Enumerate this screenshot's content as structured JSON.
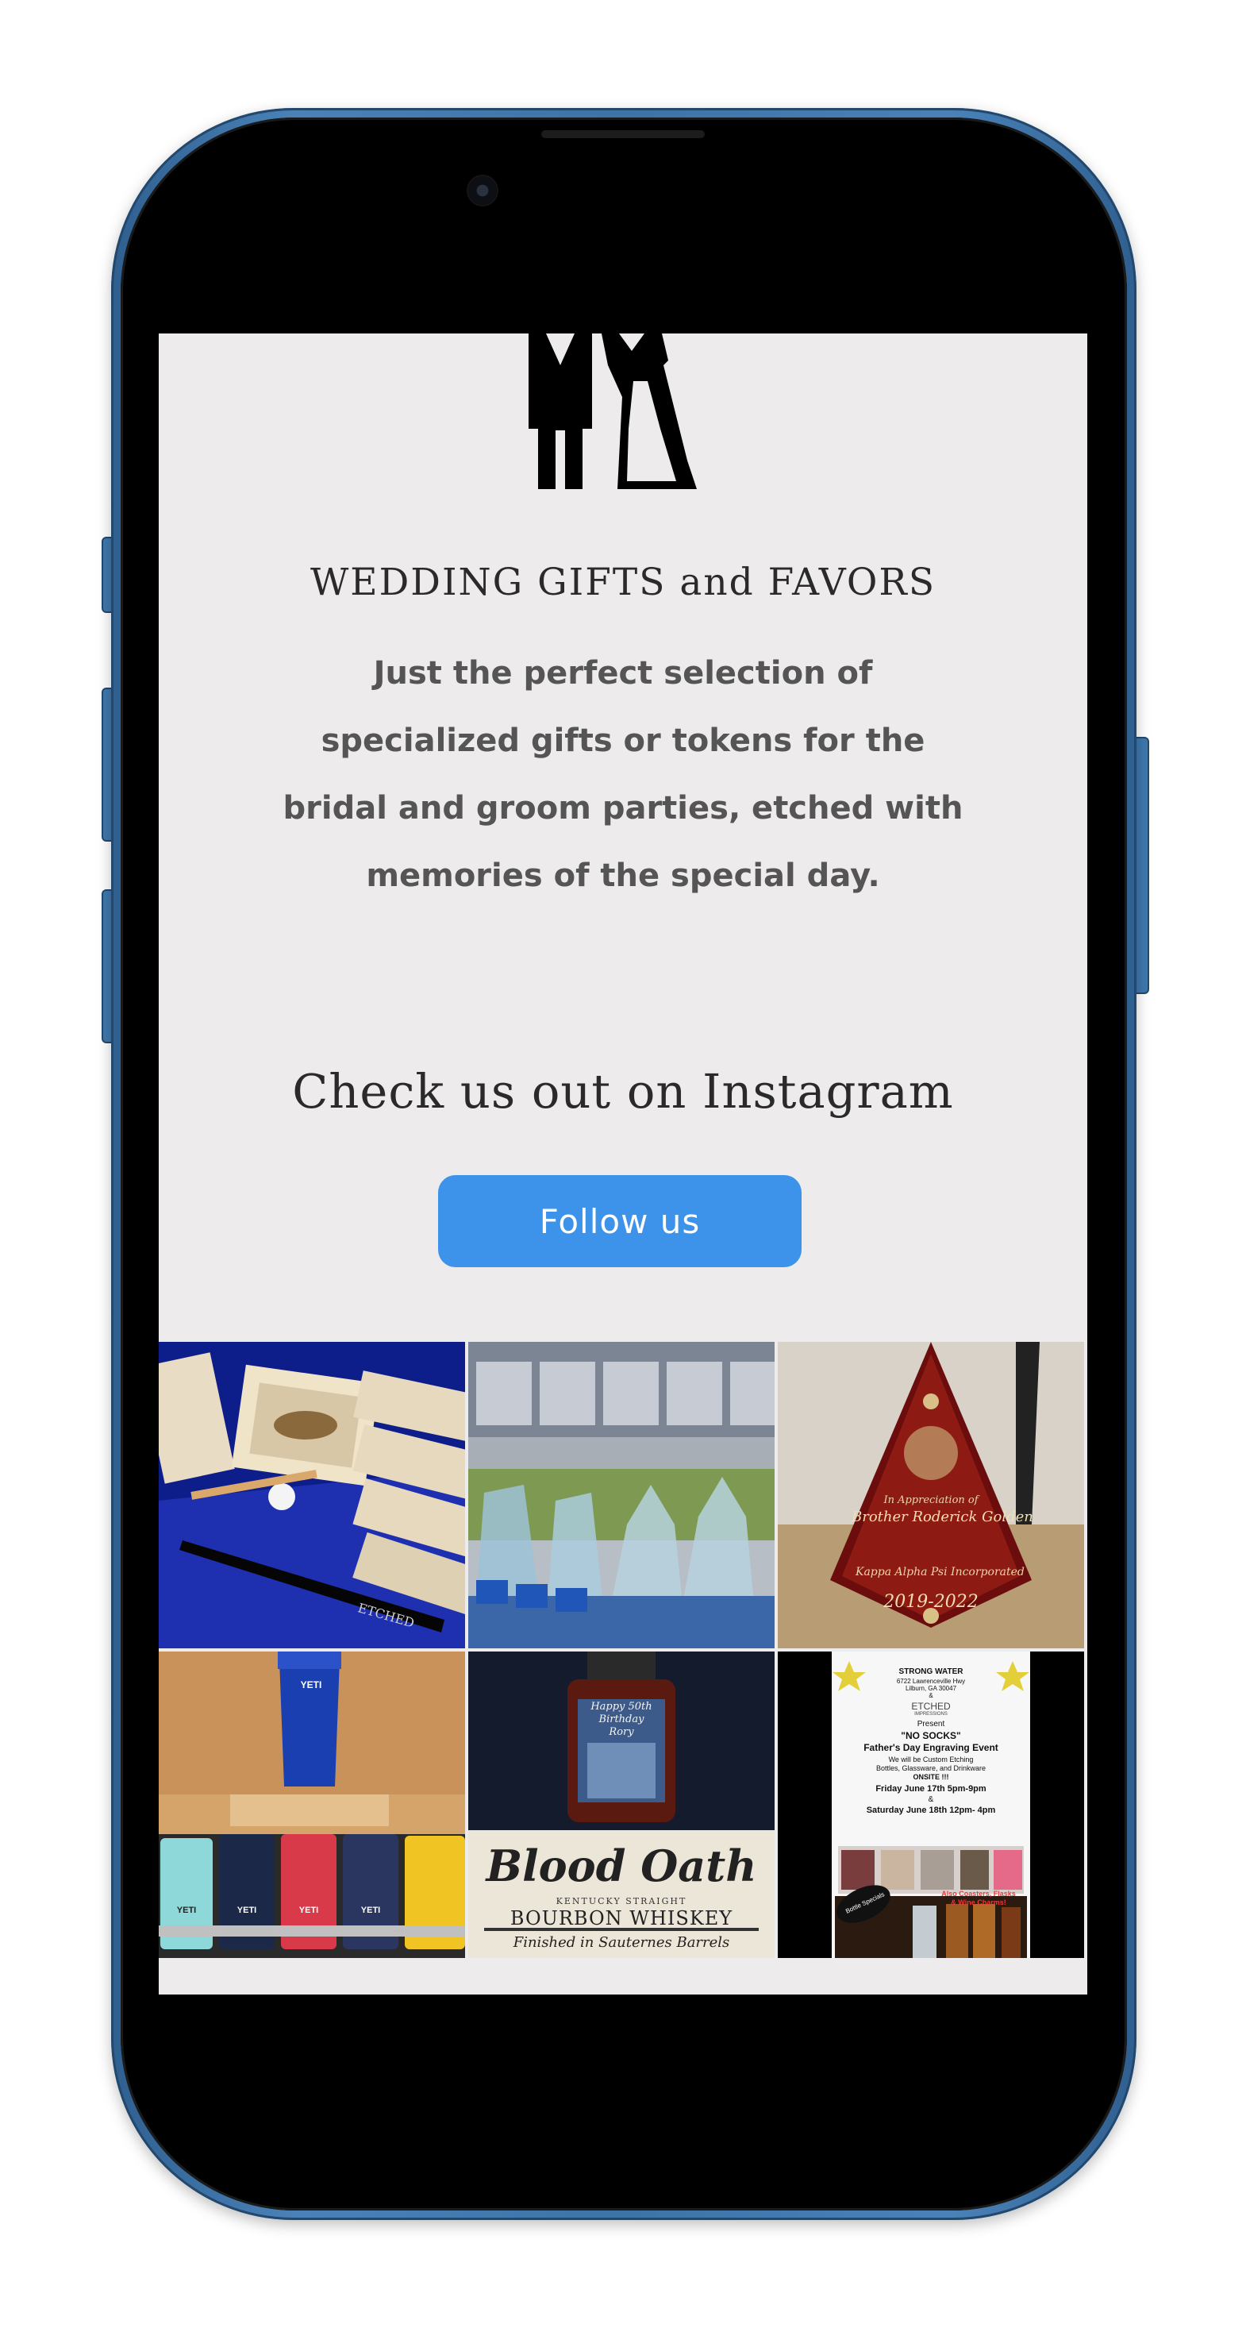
{
  "section": {
    "icon": "bride-and-groom-icon",
    "heading": "WEDDING GIFTS and FAVORS",
    "description": "Just the perfect selection of specialized gifts or tokens for the bridal and groom parties, etched with memories of the special day."
  },
  "instagram": {
    "heading": "Check us out on Instagram",
    "follow_label": "Follow us",
    "posts": [
      {
        "id": "wooden-boxes-baseball",
        "text": [
          "ETCHED"
        ]
      },
      {
        "id": "golf-awards",
        "text": []
      },
      {
        "id": "red-plaque",
        "text": [
          "In Appreciation of",
          "Brother Roderick Golden",
          "Kappa Alpha Psi Incorporated",
          "2019-2022"
        ]
      },
      {
        "id": "yeti-tumblers",
        "text": [
          "YETI",
          "YETI",
          "YETI",
          "YETI",
          "YETI"
        ]
      },
      {
        "id": "bourbon-bottle",
        "text": [
          "Happy 50th",
          "Birthday",
          "Rory",
          "Blood Oath",
          "KENTUCKY STRAIGHT",
          "BOURBON WHISKEY",
          "Finished in Sauternes Barrels"
        ]
      },
      {
        "id": "fathers-day-flyer",
        "text": [
          "STRONG WATER",
          "6722 Lawrenceville Hwy",
          "Lilburn, GA 30047",
          "&",
          "ETCHED",
          "IMPRESSIONS",
          "Present",
          "\"NO SOCKS\"",
          "Father's Day Engraving Event",
          "We will be Custom Etching",
          "Bottles, Glassware, and Drinkware",
          "ONSITE !!!",
          "Friday June 17th 5pm-9pm",
          "&",
          "Saturday June 18th 12pm- 4pm",
          "Also Coasters, Flasks",
          "& Wine Charms!",
          "Bottle Specials"
        ]
      }
    ]
  },
  "colors": {
    "screen_bg": "#edebeb",
    "button_bg": "#3d92ea",
    "button_text": "#ffffff",
    "heading": "#2a2a2a",
    "body_text": "#555555",
    "device_frame": "#3c74a8"
  }
}
